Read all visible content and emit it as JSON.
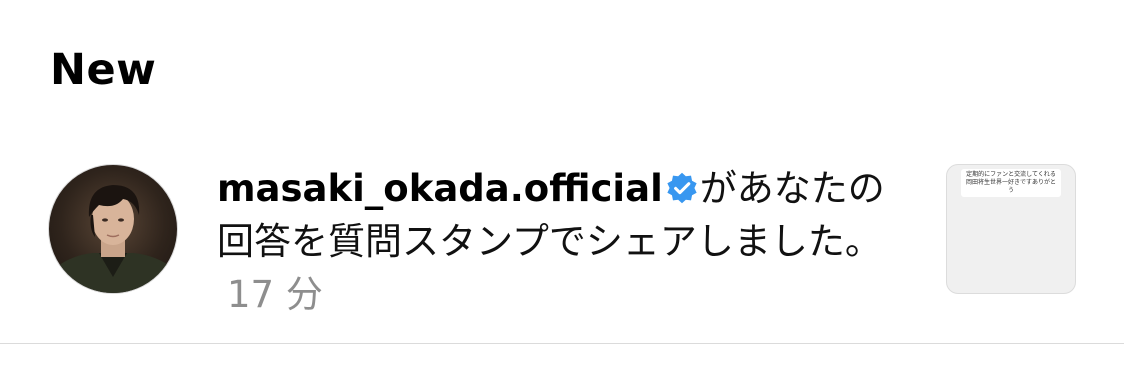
{
  "section": {
    "title": "New"
  },
  "notification": {
    "username": "masaki_okada.official",
    "message": "があなたの回答を質問スタンプでシェアしました。",
    "time": "17 分",
    "thumbnail_text": "定期的にファンと交流してくれる岡田将生世界一好きですありがとう"
  },
  "colors": {
    "verified_badge": "#3897f0",
    "timestamp": "#8e8e8e",
    "divider": "#dbdbdb"
  },
  "icons": {
    "verified": "verified-badge-icon"
  }
}
